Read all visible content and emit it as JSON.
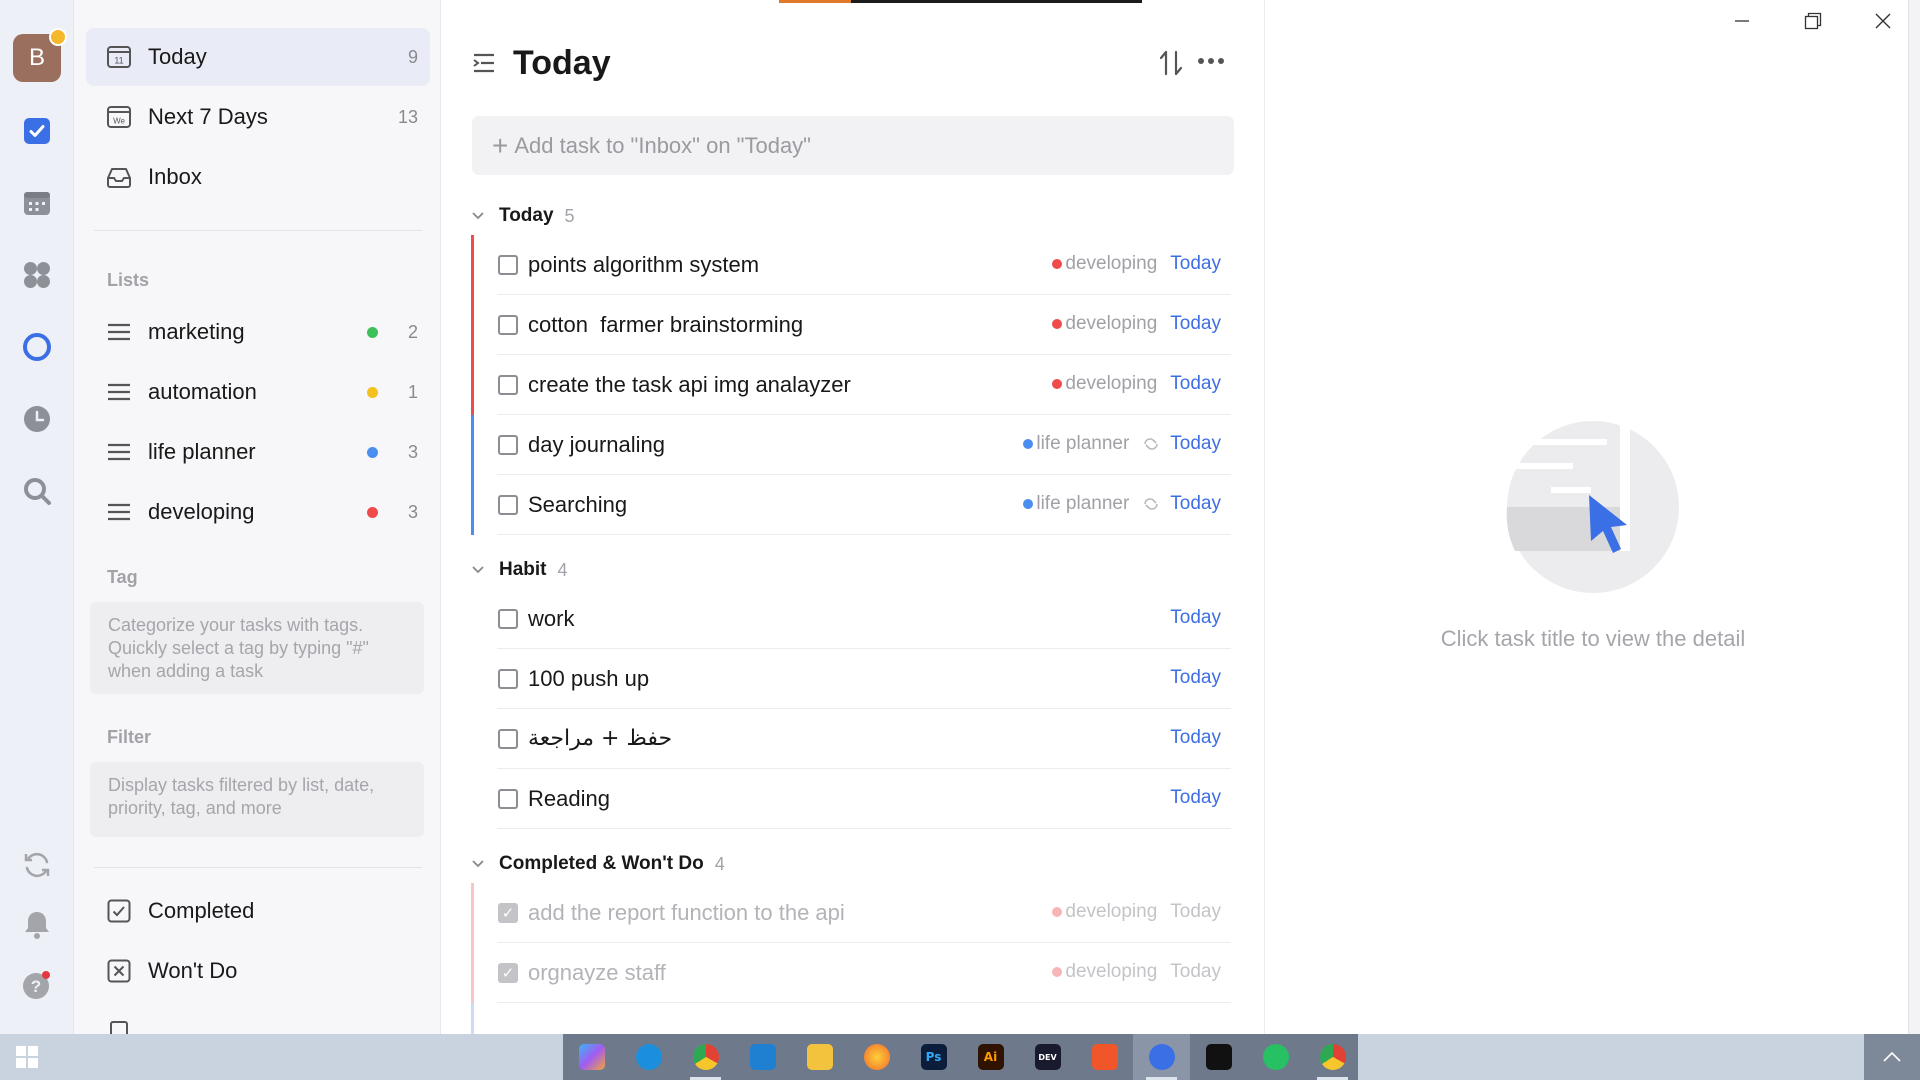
{
  "rail": {
    "avatar_letter": "B",
    "icons": [
      "checkbox-icon",
      "calendar-icon",
      "grid-icon",
      "focus-icon",
      "clock-icon",
      "search-icon",
      "sync-icon",
      "bell-icon",
      "help-icon"
    ]
  },
  "sidebar": {
    "smart_lists": [
      {
        "label": "Today",
        "count": "9",
        "icon": "calendar-day-icon"
      },
      {
        "label": "Next 7 Days",
        "count": "13",
        "icon": "calendar-week-icon"
      },
      {
        "label": "Inbox",
        "count": "",
        "icon": "inbox-icon"
      }
    ],
    "lists_header": "Lists",
    "lists": [
      {
        "label": "marketing",
        "count": "2",
        "color": "#3ec15a"
      },
      {
        "label": "automation",
        "count": "1",
        "color": "#f4c21e"
      },
      {
        "label": "life planner",
        "count": "3",
        "color": "#4a8ef0"
      },
      {
        "label": "developing",
        "count": "3",
        "color": "#ef4b4b"
      }
    ],
    "tag_header": "Tag",
    "tag_hint": "Categorize your tasks with tags. Quickly select a tag by typing \"#\" when adding a task",
    "filter_header": "Filter",
    "filter_hint": "Display tasks filtered by list, date, priority, tag, and more",
    "bottom": [
      {
        "label": "Completed",
        "icon": "check-square-icon"
      },
      {
        "label": "Won't Do",
        "icon": "x-square-icon"
      }
    ]
  },
  "main": {
    "title": "Today",
    "add_placeholder": "Add task to \"Inbox\" on \"Today\"",
    "groups": [
      {
        "title": "Today",
        "count": "5",
        "tasks": [
          {
            "title": "points algorithm system",
            "tag": "developing",
            "tag_color": "#ef4b4b",
            "due": "Today",
            "repeat": false
          },
          {
            "title": "cotton  farmer brainstorming",
            "tag": "developing",
            "tag_color": "#ef4b4b",
            "due": "Today",
            "repeat": false
          },
          {
            "title": "create the task api img analayzer",
            "tag": "developing",
            "tag_color": "#ef4b4b",
            "due": "Today",
            "repeat": false
          },
          {
            "title": "day journaling",
            "tag": "life planner",
            "tag_color": "#4a8ef0",
            "due": "Today",
            "repeat": true
          },
          {
            "title": "Searching",
            "tag": "life planner",
            "tag_color": "#4a8ef0",
            "due": "Today",
            "repeat": true
          }
        ]
      },
      {
        "title": "Habit",
        "count": "4",
        "tasks": [
          {
            "title": "work",
            "due": "Today"
          },
          {
            "title": "100 push up",
            "due": "Today"
          },
          {
            "title": "حفظ + مراجعة",
            "due": "Today"
          },
          {
            "title": "Reading",
            "due": "Today"
          }
        ]
      },
      {
        "title": "Completed & Won't Do",
        "count": "4",
        "tasks": [
          {
            "title": "add the report function to the api",
            "tag": "developing",
            "tag_color": "#f7b6b6",
            "due": "Today"
          },
          {
            "title": "orgnayze staff",
            "tag": "developing",
            "tag_color": "#f7b6b6",
            "due": "Today"
          }
        ]
      }
    ]
  },
  "detail": {
    "empty_text": "Click task title to view the detail"
  },
  "taskbar": {
    "apps": [
      "copilot-icon",
      "edge-icon",
      "chrome-icon",
      "vscode-icon",
      "file-explorer-icon",
      "firefox-icon",
      "photoshop-icon",
      "illustrator-icon",
      "dev-icon",
      "brave-icon",
      "ticktick-icon",
      "notion-icon",
      "whatsapp-icon",
      "chrome-alt-icon"
    ],
    "app_labels": {
      "photoshop": "Ps",
      "illustrator": "Ai",
      "dev": "DEV"
    }
  },
  "colors": {
    "accent": "#3d6fe3",
    "priority_red": "#ef4b4b",
    "priority_blue": "#4a8ef0"
  }
}
